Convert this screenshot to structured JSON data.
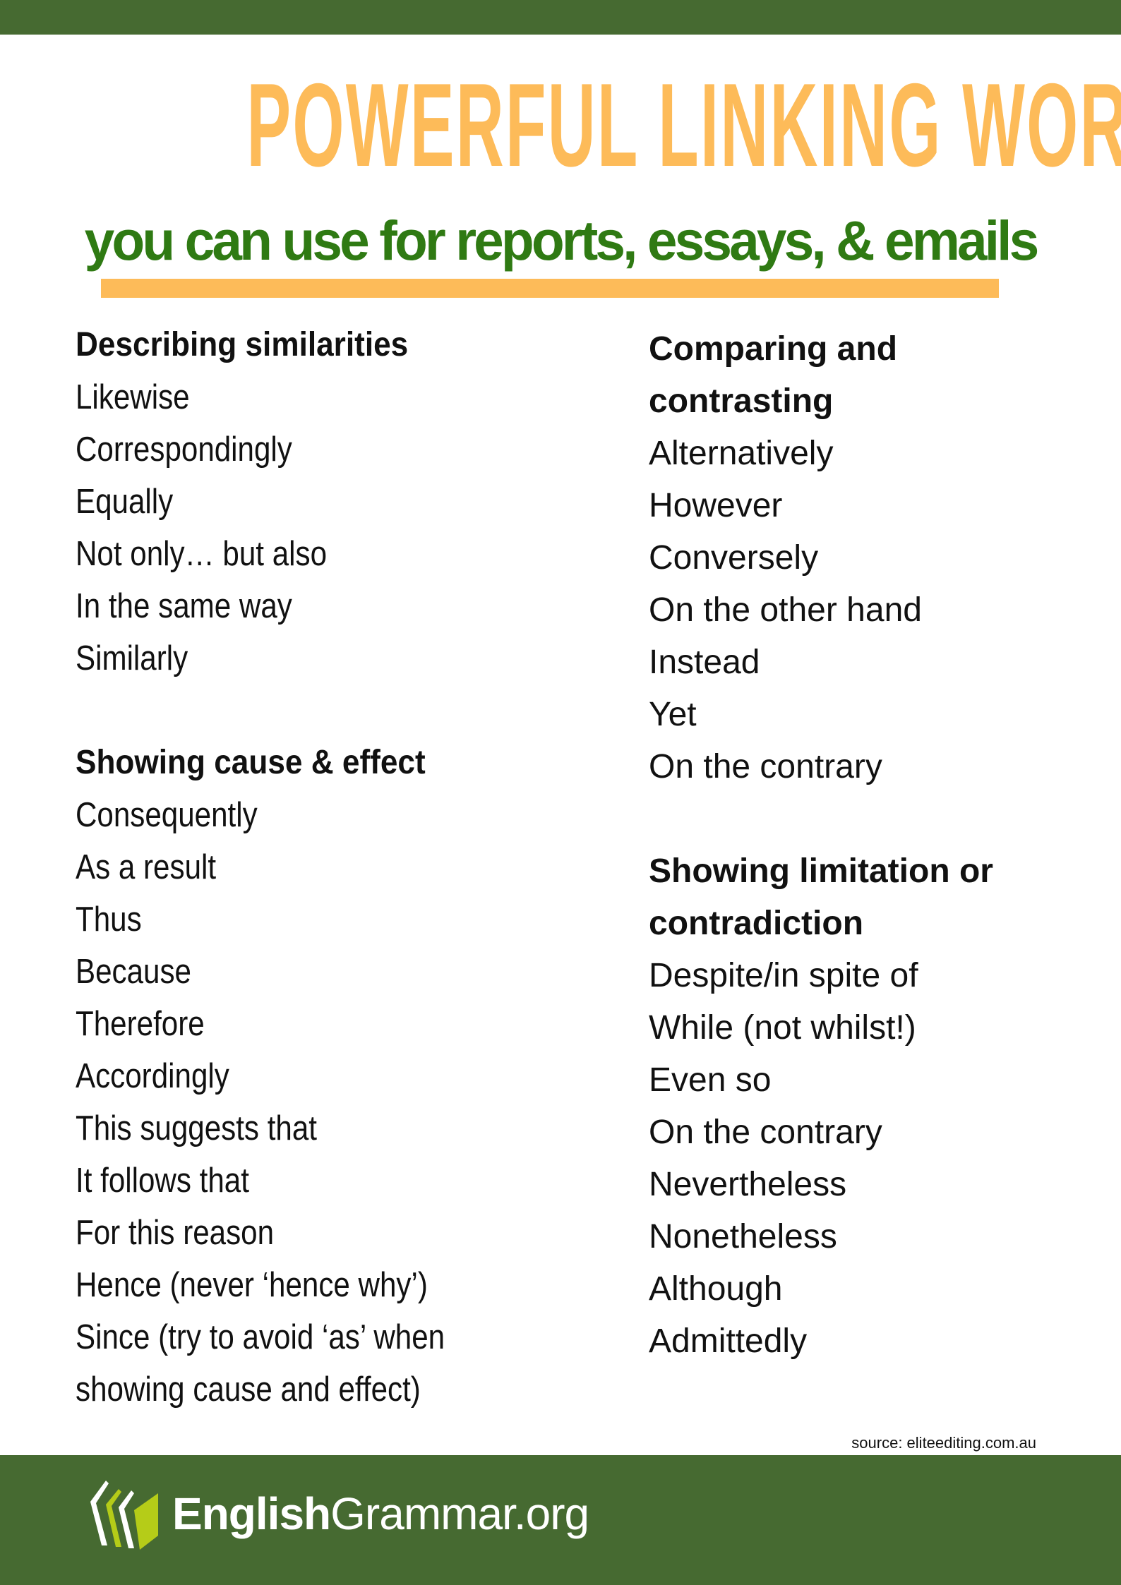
{
  "colors": {
    "top_bar": "#466a31",
    "title": "#fdbb59",
    "subtitle": "#2f7a13",
    "underline": "#fdbb59",
    "footer": "#466a31",
    "logo_accent": "#b5cc18"
  },
  "header": {
    "title": "POWERFUL LINKING WORDS",
    "subtitle": "you can use for reports, essays, & emails"
  },
  "left_column": {
    "sections": [
      {
        "heading": "Describing similarities",
        "items": [
          "Likewise",
          "Correspondingly",
          "Equally",
          "Not only… but also",
          "In the same way",
          "Similarly"
        ]
      },
      {
        "heading": "Showing cause & effect",
        "items": [
          "Consequently",
          "As a result",
          "Thus",
          "Because",
          "Therefore",
          "Accordingly",
          "This suggests that",
          "It follows that",
          "For this reason",
          "Hence (never ‘hence why’)",
          "Since (try to avoid ‘as’ when",
          "showing cause and effect)"
        ]
      }
    ]
  },
  "right_column": {
    "sections": [
      {
        "heading_lines": [
          "Comparing and",
          "contrasting"
        ],
        "items": [
          "Alternatively",
          "However",
          "Conversely",
          "On the other hand",
          "Instead",
          "Yet",
          "On the contrary"
        ]
      },
      {
        "heading_lines": [
          "Showing limitation or",
          "contradiction"
        ],
        "items": [
          "Despite/in spite of",
          "While (not whilst!)",
          "Even so",
          "On the contrary",
          "Nevertheless",
          "Nonetheless",
          "Although",
          "Admittedly"
        ]
      }
    ]
  },
  "source": "source: eliteediting.com.au",
  "footer": {
    "logo_icon": "books-icon",
    "logo_bold": "English",
    "logo_light": "Grammar.org"
  }
}
